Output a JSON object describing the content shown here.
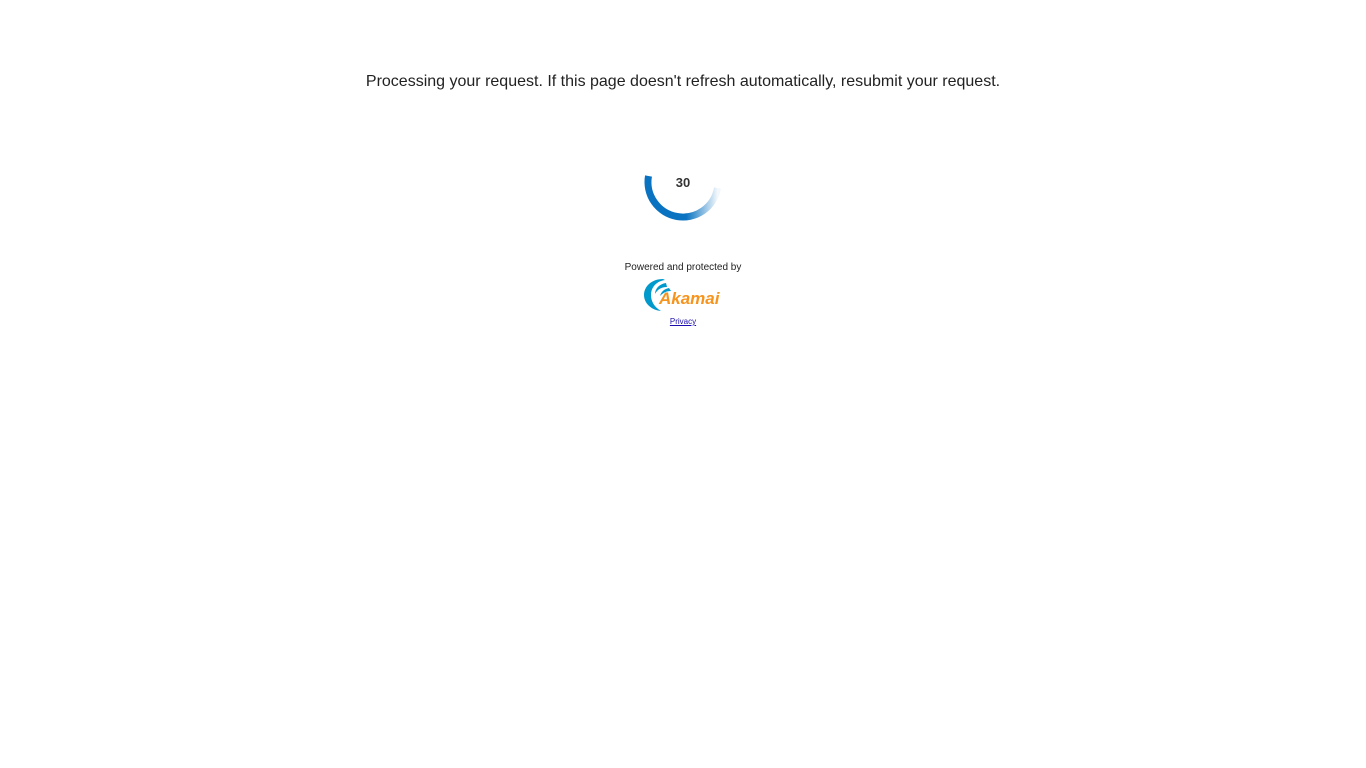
{
  "message": "Processing your request. If this page doesn't refresh automatically, resubmit your request.",
  "countdown": "30",
  "footer": {
    "powered_text": "Powered and protected by",
    "logo_text": "Akamai",
    "privacy_link": "Privacy"
  },
  "colors": {
    "spinner": "#0a73c1",
    "logo_wave": "#0099cc",
    "logo_text": "#f7941d",
    "link": "#1a0dab"
  },
  "icons": {
    "spinner": "loading-spinner-icon",
    "logo": "akamai-logo"
  }
}
